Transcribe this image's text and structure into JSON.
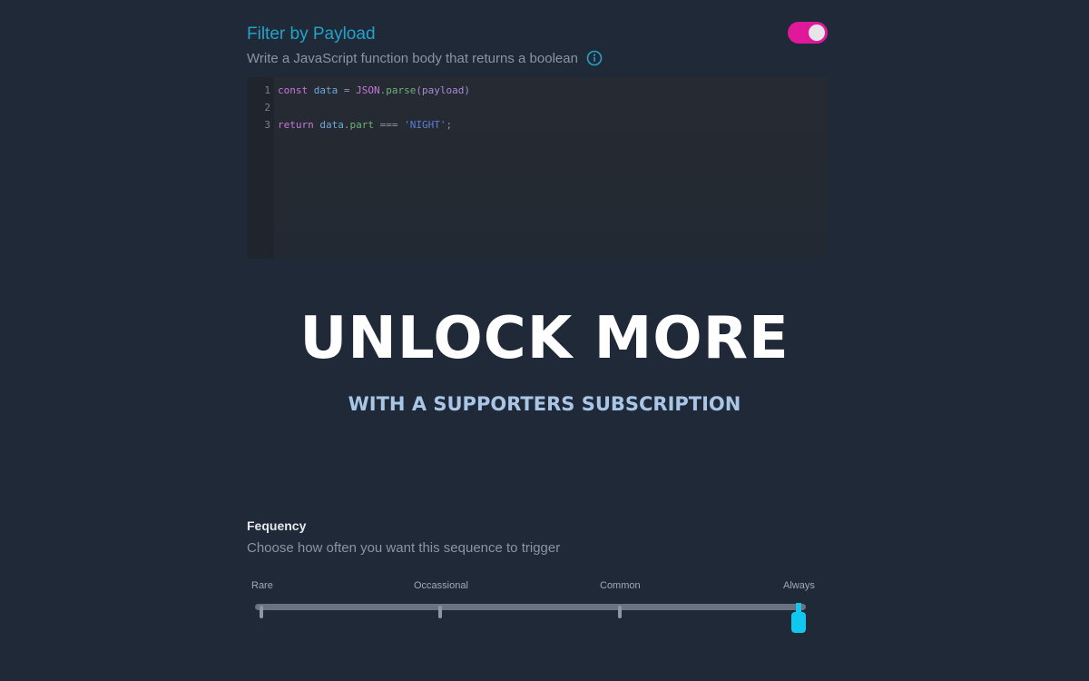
{
  "filter": {
    "title": "Filter by Payload",
    "subtitle": "Write a JavaScript function body that returns a boolean",
    "toggle_on": true
  },
  "editor": {
    "line_numbers": [
      "1",
      "2",
      "3"
    ],
    "line1": {
      "kw": "const",
      "var": "data",
      "op": "=",
      "obj": "JSON",
      "dot": ".",
      "fn": "parse",
      "paren_open": "(",
      "arg": "payload",
      "paren_close": ")"
    },
    "line3": {
      "kw": "return",
      "obj": "data",
      "dot": ".",
      "prop": "part",
      "op": "===",
      "str": "'NIGHT'",
      "semi": ";"
    }
  },
  "overlay": {
    "title": "UNLOCK MORE",
    "subtitle": "WITH A SUPPORTERS SUBSCRIPTION"
  },
  "frequency": {
    "title": "Fequency",
    "subtitle": "Choose how often you want this sequence to trigger",
    "options": [
      "Rare",
      "Occassional",
      "Common",
      "Always"
    ],
    "selected": "Always"
  },
  "colors": {
    "accent": "#22a3c7",
    "toggle": "#e0199a",
    "slider_thumb": "#12c7ef",
    "background": "#1f2937"
  }
}
